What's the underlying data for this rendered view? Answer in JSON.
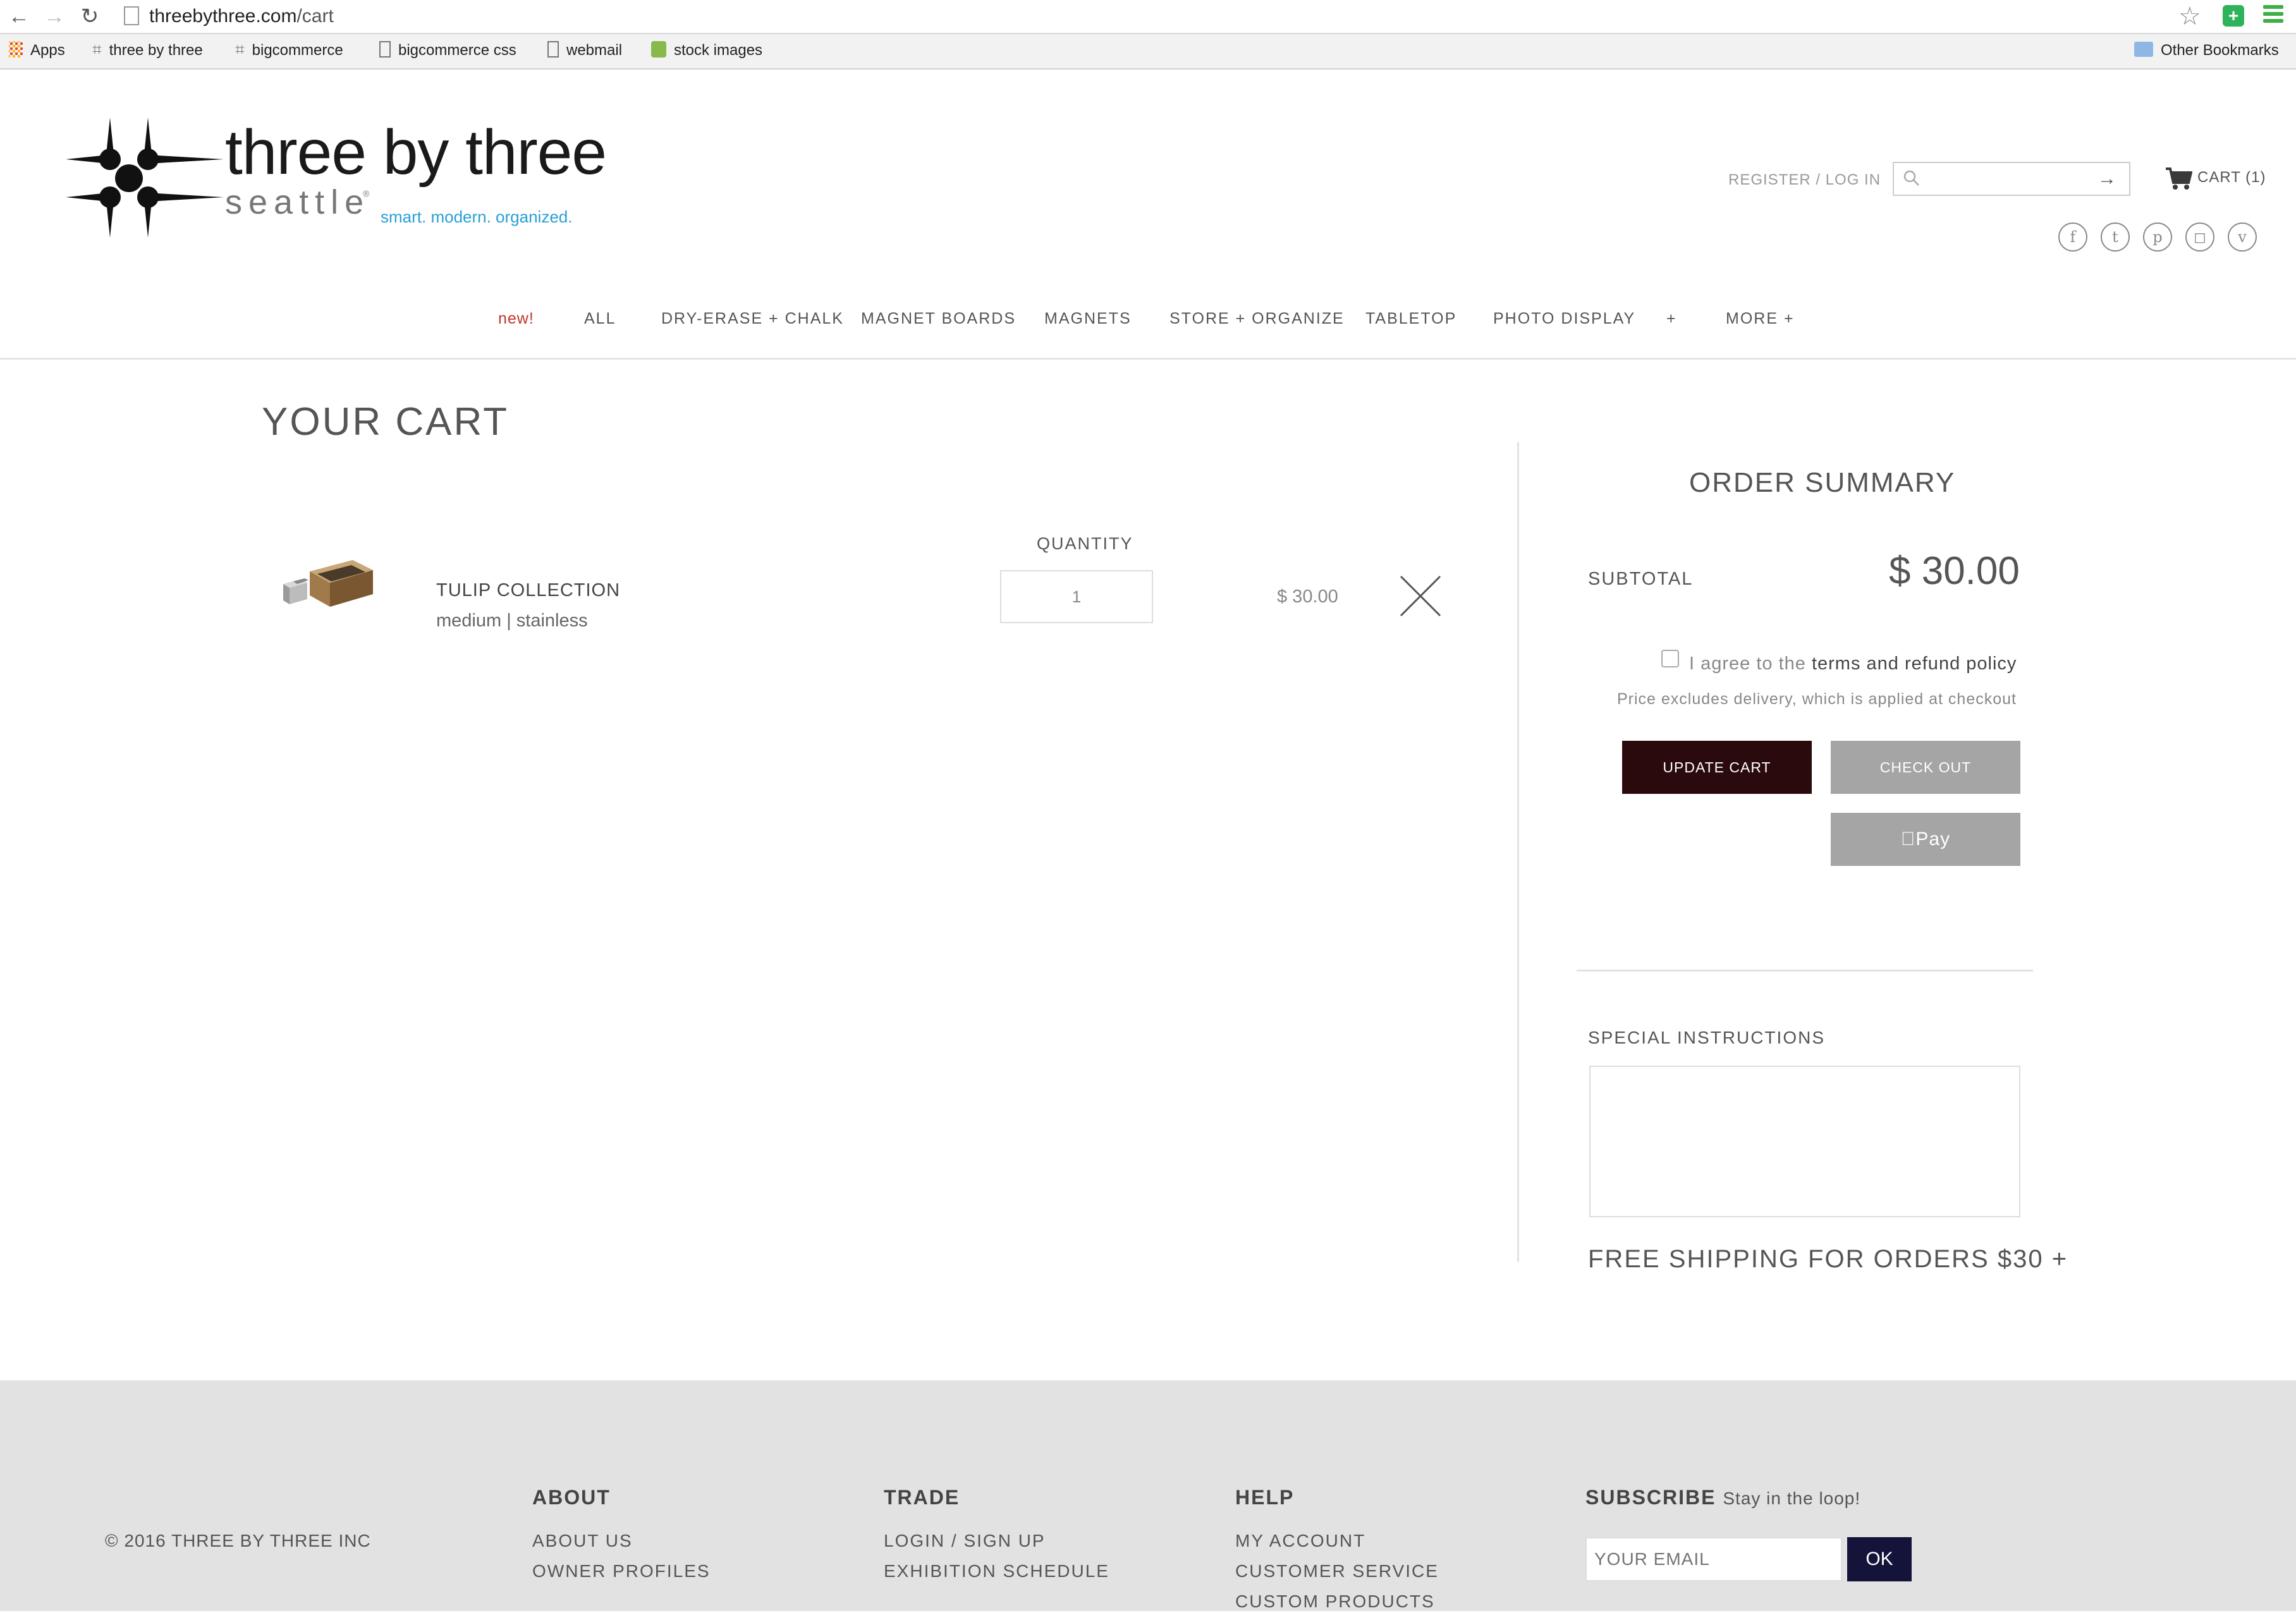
{
  "browser": {
    "url_host": "threebythree.com",
    "url_path": "/cart",
    "bookmarks": [
      "Apps",
      "three by three",
      "bigcommerce",
      "bigcommerce css",
      "webmail",
      "stock images"
    ],
    "other_bookmarks": "Other Bookmarks"
  },
  "header": {
    "logo_title": "three by three",
    "logo_sub": "seattle",
    "logo_reg": "®",
    "logo_tagline": "smart. modern. organized.",
    "register_login": "REGISTER / LOG IN",
    "search_placeholder": "",
    "cart_label": "CART (1)",
    "social": [
      "facebook-icon",
      "twitter-icon",
      "pinterest-icon",
      "instagram-icon",
      "vimeo-icon"
    ]
  },
  "nav": {
    "items": [
      "new!",
      "ALL",
      "DRY-ERASE + CHALK",
      "MAGNET BOARDS",
      "MAGNETS",
      "STORE + ORGANIZE",
      "TABLETOP",
      "PHOTO DISPLAY",
      "+",
      "MORE +"
    ]
  },
  "cart": {
    "title": "YOUR CART",
    "quantity_label": "QUANTITY",
    "items": [
      {
        "name": "TULIP COLLECTION",
        "variant": "medium | stainless",
        "quantity": "1",
        "price": "$ 30.00"
      }
    ]
  },
  "summary": {
    "title": "ORDER SUMMARY",
    "subtotal_label": "SUBTOTAL",
    "subtotal_value": "$ 30.00",
    "agree_prefix": "I agree to the ",
    "agree_link": "terms and refund policy",
    "delivery_note": "Price excludes delivery, which is applied at checkout",
    "update_cart": "UPDATE CART",
    "check_out": "CHECK OUT",
    "apple_pay": "Pay",
    "special_instructions": "SPECIAL INSTRUCTIONS",
    "free_shipping": "FREE SHIPPING FOR ORDERS $30 +"
  },
  "footer": {
    "copyright": "© 2016 THREE BY THREE INC",
    "about": {
      "heading": "ABOUT",
      "links": [
        "ABOUT US",
        "OWNER PROFILES"
      ]
    },
    "trade": {
      "heading": "TRADE",
      "links": [
        "LOGIN / SIGN UP",
        "EXHIBITION SCHEDULE"
      ]
    },
    "help": {
      "heading": "HELP",
      "links": [
        "MY ACCOUNT",
        "CUSTOMER SERVICE",
        "CUSTOM PRODUCTS"
      ]
    },
    "subscribe": {
      "heading": "SUBSCRIBE",
      "tagline": "Stay in the loop!",
      "placeholder": "YOUR EMAIL",
      "button": "OK"
    }
  },
  "colors": {
    "accent_new": "#c0392b",
    "update_button": "#2a0a0c",
    "checkout_button": "#a5a5a5",
    "subscribe_button": "#14143a",
    "tagline_blue": "#2a9fd6",
    "footer_bg": "#e2e2e2"
  }
}
